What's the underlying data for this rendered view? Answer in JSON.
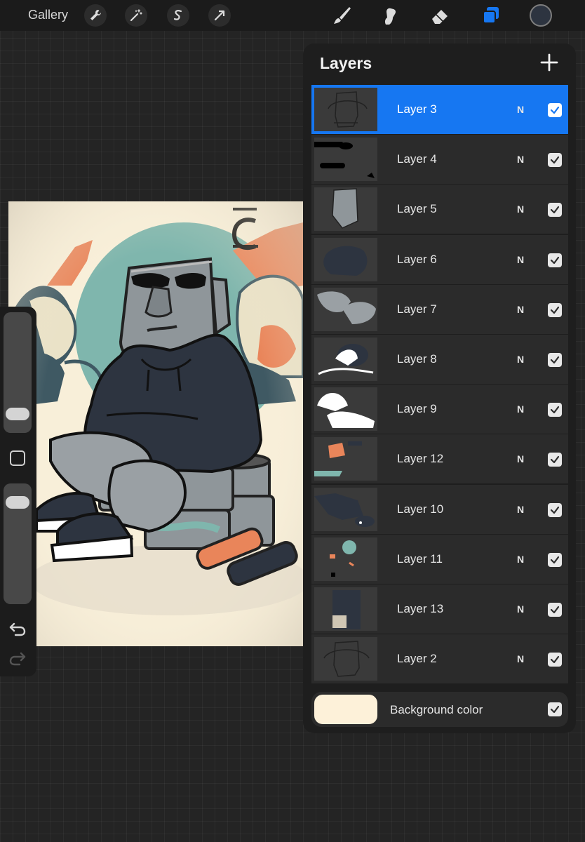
{
  "toolbar": {
    "gallery_label": "Gallery",
    "left_tools": [
      "wrench-icon",
      "magic-wand-icon",
      "selection-s-icon",
      "transform-arrow-icon"
    ],
    "right_tools": [
      "brush-icon",
      "smudge-icon",
      "eraser-icon",
      "layers-icon"
    ],
    "active_tool": "layers-icon",
    "current_color": "#2d3440"
  },
  "sidebar": {
    "brush_size_level": 0.1,
    "opacity_level": 0.9,
    "undo_icon": "undo-icon",
    "redo_icon": "redo-icon"
  },
  "layers": {
    "title": "Layers",
    "add_icon": "plus-icon",
    "items": [
      {
        "name": "Layer 3",
        "blend": "N",
        "visible": true,
        "selected": true
      },
      {
        "name": "Layer 4",
        "blend": "N",
        "visible": true
      },
      {
        "name": "Layer 5",
        "blend": "N",
        "visible": true
      },
      {
        "name": "Layer 6",
        "blend": "N",
        "visible": true
      },
      {
        "name": "Layer 7",
        "blend": "N",
        "visible": true
      },
      {
        "name": "Layer 8",
        "blend": "N",
        "visible": true
      },
      {
        "name": "Layer 9",
        "blend": "N",
        "visible": true
      },
      {
        "name": "Layer 12",
        "blend": "N",
        "visible": true
      },
      {
        "name": "Layer 10",
        "blend": "N",
        "visible": true
      },
      {
        "name": "Layer 11",
        "blend": "N",
        "visible": true
      },
      {
        "name": "Layer 13",
        "blend": "N",
        "visible": true
      },
      {
        "name": "Layer 2",
        "blend": "N",
        "visible": true
      }
    ],
    "background": {
      "name": "Background color",
      "color": "#fdf1d9",
      "visible": true
    }
  },
  "colors": {
    "accent": "#1677f2"
  }
}
